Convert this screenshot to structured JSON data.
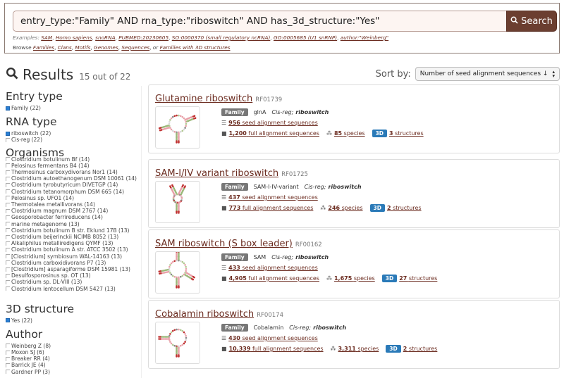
{
  "search": {
    "query": "entry_type:\"Family\" AND rna_type:\"riboswitch\" AND has_3d_structure:\"Yes\"",
    "button_label": "Search",
    "examples_label": "Examples:",
    "examples": [
      "SAM",
      "Homo sapiens",
      "snoRNA",
      "PUBMED:20230605",
      "SO:0000370 (small regulatory ncRNA)",
      "GO:0005685 (U1 snRNP)",
      "author:\"Weinberg\""
    ],
    "browse_label": "Browse",
    "browse_links": [
      "Families",
      "Clans",
      "Motifs",
      "Genomes",
      "Sequences"
    ],
    "browse_or": "or",
    "browse_last": "Families with 3D structures"
  },
  "results": {
    "title": "Results",
    "count": "15 out of 22",
    "sort_label": "Sort by:",
    "sort_value": "Number of seed alignment sequences ↓"
  },
  "facets": {
    "entry_type": {
      "title": "Entry type",
      "items": [
        {
          "label": "Family (22)",
          "checked": true
        }
      ]
    },
    "rna_type": {
      "title": "RNA type",
      "items": [
        {
          "label": "riboswitch (22)",
          "checked": true
        },
        {
          "label": "Cis-reg (22)",
          "checked": false
        }
      ]
    },
    "organisms": {
      "title": "Organisms",
      "items": [
        "Clostridium botulinum Bf (14)",
        "Pelosinus fermentans B4 (14)",
        "Thermosinus carboxydivorans Nor1 (14)",
        "Clostridium autoethanogenum DSM 10061 (14)",
        "Clostridium tyrobutyricum DIVETGP (14)",
        "Clostridium tetanomorphum DSM 665 (14)",
        "Pelosinus sp. UFO1 (14)",
        "Thermotalea metallivorans (14)",
        "Clostridium magnum DSM 2767 (14)",
        "Geosporobacter ferrireducens (14)",
        "marine metagenome (13)",
        "Clostridium botulinum B str. Eklund 17B (13)",
        "Clostridium beijerinckii NCIMB 8052 (13)",
        "Alkaliphilus metalliredigens QYMF (13)",
        "Clostridium botulinum A str. ATCC 3502 (13)",
        "[Clostridium] symbiosum WAL-14163 (13)",
        "Clostridium carboxidivorans P7 (13)",
        "[Clostridium] asparagiforme DSM 15981 (13)",
        "Desulfosporosinus sp. OT (13)",
        "Clostridium sp. DL-VIII (13)",
        "Clostridium lentocellum DSM 5427 (13)"
      ]
    },
    "structure_3d": {
      "title": "3D structure",
      "items": [
        {
          "label": "Yes (22)",
          "checked": true
        }
      ]
    },
    "author": {
      "title": "Author",
      "items": [
        "Weinberg Z (8)",
        "Moxon SJ (6)",
        "Breaker RR (4)",
        "Barrick JE (4)",
        "Gardner PP (3)"
      ]
    }
  },
  "cards": [
    {
      "title": "Glutamine riboswitch",
      "accession": "RF01739",
      "badge": "Family",
      "id": "glnA",
      "type_prefix": "Cis-reg;",
      "type": "riboswitch",
      "seed": "956",
      "seed_label": "seed alignment sequences",
      "full": "1,200",
      "full_label": "full alignment sequences",
      "species": "85",
      "species_label": "species",
      "badge_3d": "3D",
      "structures": "3",
      "structures_label": "structures"
    },
    {
      "title": "SAM-I/IV variant riboswitch",
      "accession": "RF01725",
      "badge": "Family",
      "id": "SAM-I-IV-variant",
      "type_prefix": "Cis-reg;",
      "type": "riboswitch",
      "seed": "437",
      "seed_label": "seed alignment sequences",
      "full": "773",
      "full_label": "full alignment sequences",
      "species": "246",
      "species_label": "species",
      "badge_3d": "3D",
      "structures": "2",
      "structures_label": "structures"
    },
    {
      "title": "SAM riboswitch (S box leader)",
      "accession": "RF00162",
      "badge": "Family",
      "id": "SAM",
      "type_prefix": "Cis-reg;",
      "type": "riboswitch",
      "seed": "433",
      "seed_label": "seed alignment sequences",
      "full": "4,905",
      "full_label": "full alignment sequences",
      "species": "1,675",
      "species_label": "species",
      "badge_3d": "3D",
      "structures": "27",
      "structures_label": "structures"
    },
    {
      "title": "Cobalamin riboswitch",
      "accession": "RF00174",
      "badge": "Family",
      "id": "Cobalamin",
      "type_prefix": "Cis-reg;",
      "type": "riboswitch",
      "seed": "430",
      "seed_label": "seed alignment sequences",
      "full": "10,339",
      "full_label": "full alignment sequences",
      "species": "3,311",
      "species_label": "species",
      "badge_3d": "3D",
      "structures": "2",
      "structures_label": "structures"
    }
  ]
}
